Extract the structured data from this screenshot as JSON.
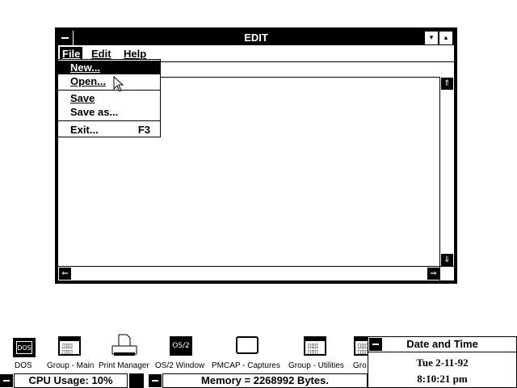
{
  "edit_window": {
    "title": "EDIT",
    "menus": [
      "File",
      "Edit",
      "Help"
    ],
    "min_glyph": "▾",
    "max_glyph": "▴",
    "scroll_up": "⇑",
    "scroll_down": "⇓",
    "scroll_left": "⇐",
    "scroll_right": "⇒"
  },
  "file_menu": {
    "items": [
      {
        "label": "New...",
        "accelerator": ""
      },
      {
        "label": "Open...",
        "accelerator": ""
      },
      {
        "label": "Save",
        "accelerator": ""
      },
      {
        "label": "Save as...",
        "accelerator": ""
      },
      {
        "label": "Exit...",
        "accelerator": "F3"
      }
    ],
    "selected_index": 0
  },
  "desktop_icons": [
    {
      "label": "DOS",
      "badge": "DOS",
      "icon": "dos-icon"
    },
    {
      "label": "Group - Main",
      "badge": "",
      "icon": "group-icon"
    },
    {
      "label": "Print Manager",
      "badge": "",
      "icon": "printer-icon"
    },
    {
      "label": "OS/2 Window",
      "badge": "OS/2",
      "icon": "os2-window-icon"
    },
    {
      "label": "PMCAP - Captures",
      "badge": "",
      "icon": "window-icon"
    },
    {
      "label": "Group - Utilities",
      "badge": "",
      "icon": "group-icon"
    },
    {
      "label": "Gro",
      "badge": "",
      "icon": "group-icon"
    }
  ],
  "cpu_usage": "CPU Usage: 10%",
  "memory": "Memory = 2268992 Bytes.",
  "date_time": {
    "title": "Date and Time",
    "date": "Tue  2-11-92",
    "time": "8:10:21 pm"
  },
  "colors": {
    "foreground": "#000000",
    "background": "#ffffff"
  }
}
